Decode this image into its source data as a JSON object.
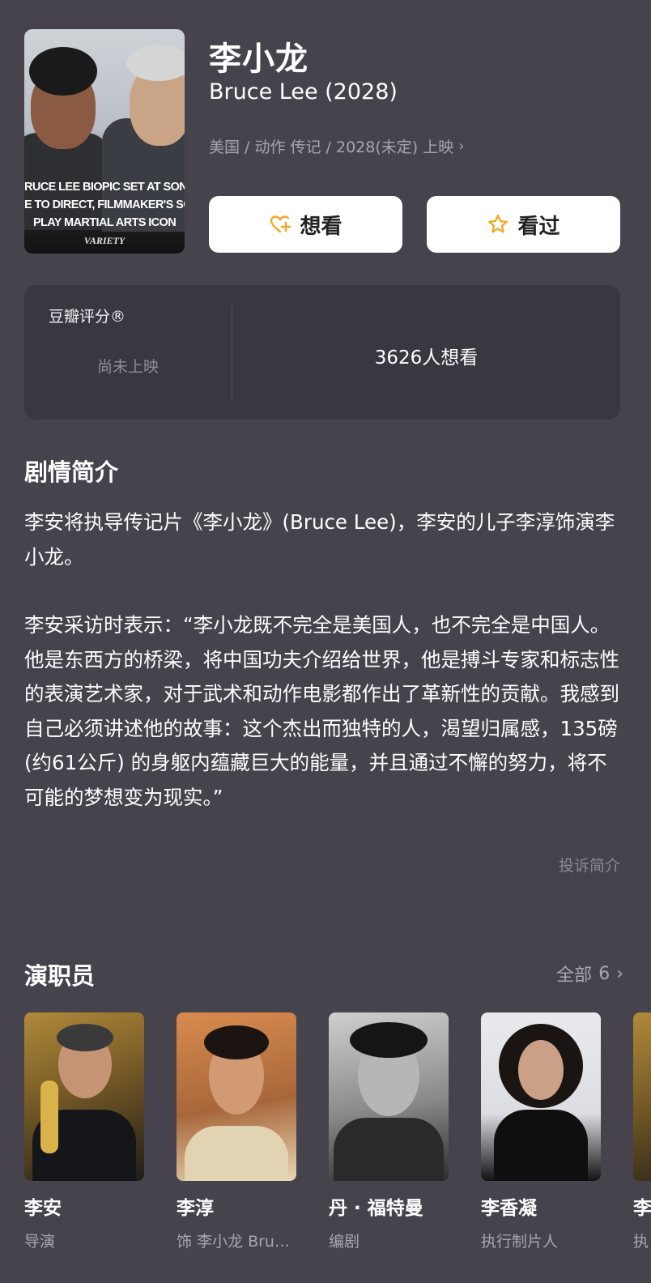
{
  "movie": {
    "title_cn": "李小龙",
    "title_en": "Bruce Lee (2028)",
    "meta": "美国 / 动作 传记 / 2028(未定) 上映",
    "poster_caption": [
      "RUCE LEE BIOPIC SET AT SONY: AN",
      "E TO DIRECT, FILMMAKER'S SON T",
      "PLAY MARTIAL ARTS ICON"
    ],
    "poster_brand": "VARIETY"
  },
  "actions": {
    "want_label": "想看",
    "seen_label": "看过",
    "accent_color": "#f5a623"
  },
  "rating": {
    "label": "豆瓣评分®",
    "status": "尚未上映",
    "wish_count": "3626人想看"
  },
  "synopsis": {
    "title": "剧情简介",
    "paragraphs": [
      "李安将执导传记片《李小龙》(Bruce Lee)，李安的儿子李淳饰演李小龙。",
      "李安采访时表示：“李小龙既不完全是美国人，也不完全是中国人。他是东西方的桥梁，将中国功夫介绍给世界，他是搏斗专家和标志性的表演艺术家，对于武术和动作电影都作出了革新性的贡献。我感到自己必须讲述他的故事：这个杰出而独特的人，渴望归属感，135磅(约61公斤) 的身躯内蕴藏巨大的能量，并且通过不懈的努力，将不可能的梦想变为现实。”"
    ],
    "report_label": "投诉简介"
  },
  "cast": {
    "title": "演职员",
    "all_label": "全部",
    "count": "6",
    "members": [
      {
        "name": "李安",
        "role": "导演"
      },
      {
        "name": "李淳",
        "role": "饰 李小龙 Bruce Lee"
      },
      {
        "name": "丹 · 福特曼",
        "role": "编剧"
      },
      {
        "name": "李香凝",
        "role": "执行制片人"
      },
      {
        "name": "李",
        "role": "执"
      }
    ]
  }
}
